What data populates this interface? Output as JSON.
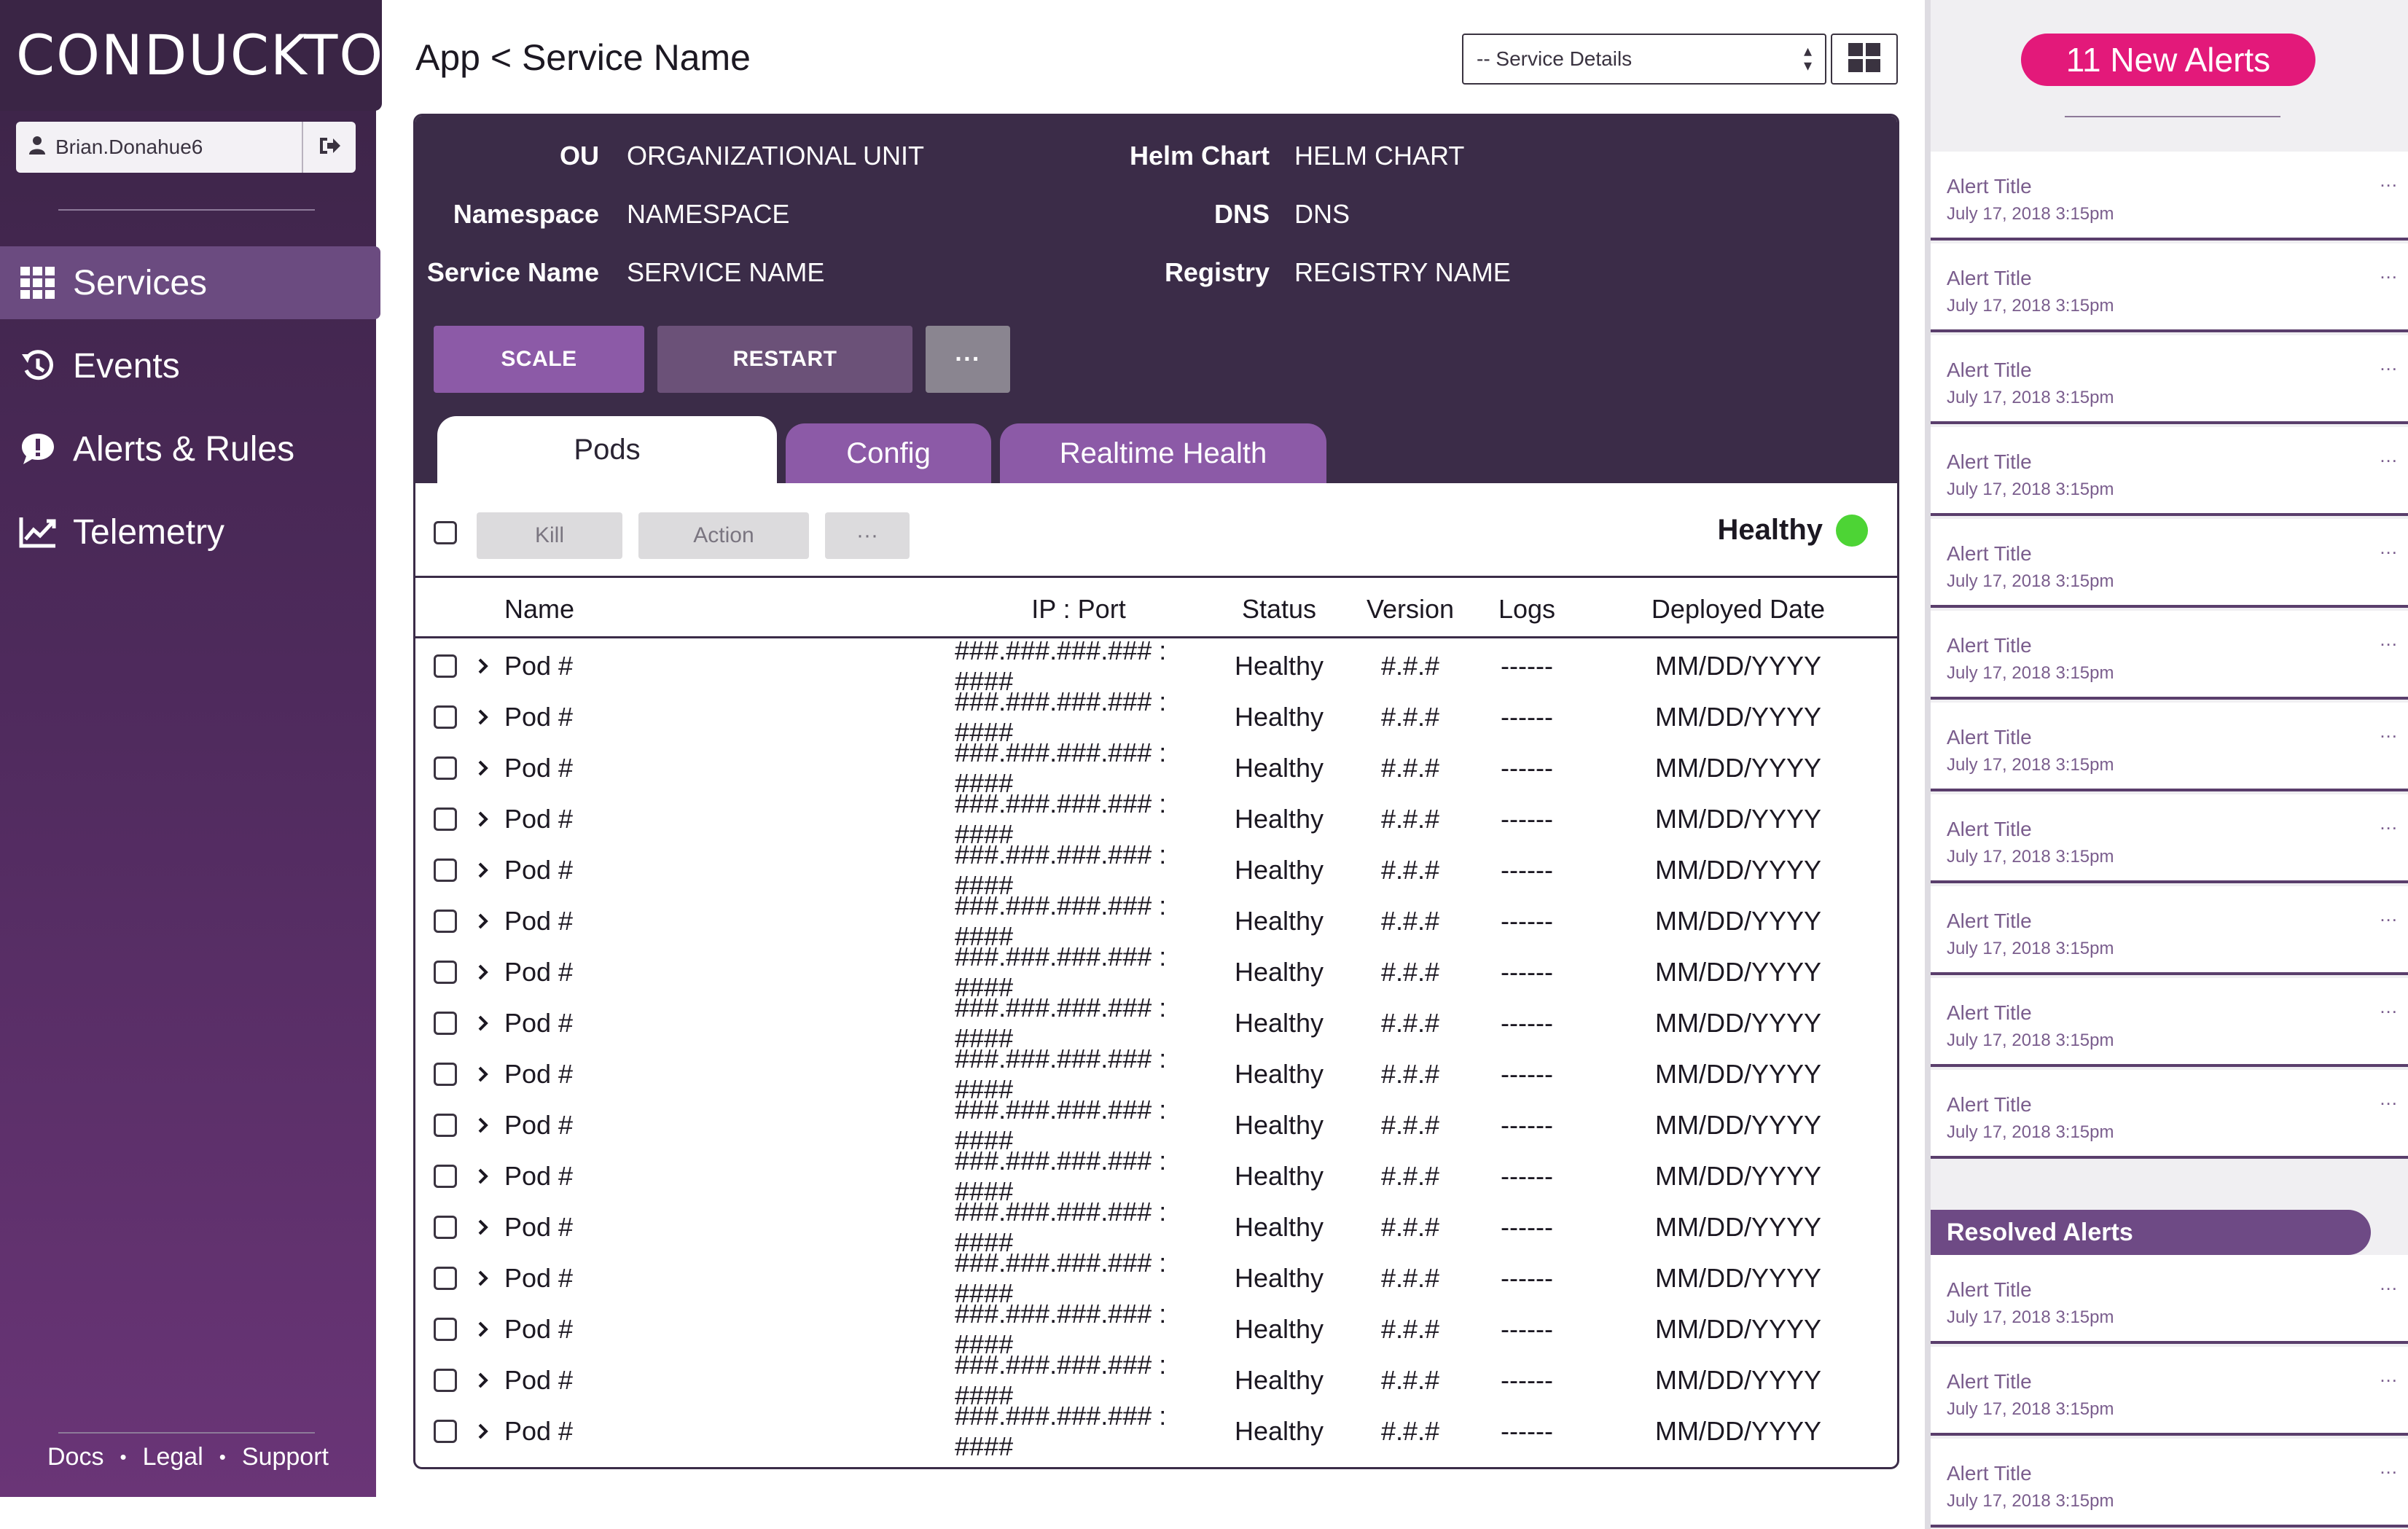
{
  "app": {
    "brand": "CONDUCKTOR",
    "username": "Brian.Donahue6",
    "breadcrumb": "App < Service Name"
  },
  "sidebar": {
    "items": [
      {
        "label": "Services",
        "icon": "grid-icon",
        "active": true
      },
      {
        "label": "Events",
        "icon": "history-icon",
        "active": false
      },
      {
        "label": "Alerts & Rules",
        "icon": "alert-bubble-icon",
        "active": false
      },
      {
        "label": "Telemetry",
        "icon": "line-chart-icon",
        "active": false
      }
    ],
    "footer": {
      "docs": "Docs",
      "legal": "Legal",
      "support": "Support",
      "separator": "•"
    }
  },
  "header": {
    "select_value": "-- Service Details"
  },
  "service": {
    "fields": [
      {
        "key": "OU",
        "value": "ORGANIZATIONAL UNIT"
      },
      {
        "key": "Namespace",
        "value": "NAMESPACE"
      },
      {
        "key": "Service Name",
        "value": "SERVICE NAME"
      },
      {
        "key": "Helm Chart",
        "value": "HELM CHART"
      },
      {
        "key": "DNS",
        "value": "DNS"
      },
      {
        "key": "Registry",
        "value": "REGISTRY NAME"
      }
    ],
    "actions": {
      "scale": "SCALE",
      "restart": "RESTART",
      "more": "···"
    }
  },
  "tabs": [
    {
      "label": "Pods",
      "active": true
    },
    {
      "label": "Config",
      "active": false
    },
    {
      "label": "Realtime Health",
      "active": false
    }
  ],
  "toolbar": {
    "kill": "Kill",
    "action": "Action",
    "more": "···",
    "health_label": "Healthy",
    "health_color": "#4dd435"
  },
  "table": {
    "columns": [
      "Name",
      "IP : Port",
      "Status",
      "Version",
      "Logs",
      "Deployed Date"
    ],
    "rows": [
      [
        "Pod #",
        "###.###.###.### : ####",
        "Healthy",
        "#.#.#",
        "------",
        "MM/DD/YYYY"
      ],
      [
        "Pod #",
        "###.###.###.### : ####",
        "Healthy",
        "#.#.#",
        "------",
        "MM/DD/YYYY"
      ],
      [
        "Pod #",
        "###.###.###.### : ####",
        "Healthy",
        "#.#.#",
        "------",
        "MM/DD/YYYY"
      ],
      [
        "Pod #",
        "###.###.###.### : ####",
        "Healthy",
        "#.#.#",
        "------",
        "MM/DD/YYYY"
      ],
      [
        "Pod #",
        "###.###.###.### : ####",
        "Healthy",
        "#.#.#",
        "------",
        "MM/DD/YYYY"
      ],
      [
        "Pod #",
        "###.###.###.### : ####",
        "Healthy",
        "#.#.#",
        "------",
        "MM/DD/YYYY"
      ],
      [
        "Pod #",
        "###.###.###.### : ####",
        "Healthy",
        "#.#.#",
        "------",
        "MM/DD/YYYY"
      ],
      [
        "Pod #",
        "###.###.###.### : ####",
        "Healthy",
        "#.#.#",
        "------",
        "MM/DD/YYYY"
      ],
      [
        "Pod #",
        "###.###.###.### : ####",
        "Healthy",
        "#.#.#",
        "------",
        "MM/DD/YYYY"
      ],
      [
        "Pod #",
        "###.###.###.### : ####",
        "Healthy",
        "#.#.#",
        "------",
        "MM/DD/YYYY"
      ],
      [
        "Pod #",
        "###.###.###.### : ####",
        "Healthy",
        "#.#.#",
        "------",
        "MM/DD/YYYY"
      ],
      [
        "Pod #",
        "###.###.###.### : ####",
        "Healthy",
        "#.#.#",
        "------",
        "MM/DD/YYYY"
      ],
      [
        "Pod #",
        "###.###.###.### : ####",
        "Healthy",
        "#.#.#",
        "------",
        "MM/DD/YYYY"
      ],
      [
        "Pod #",
        "###.###.###.### : ####",
        "Healthy",
        "#.#.#",
        "------",
        "MM/DD/YYYY"
      ],
      [
        "Pod #",
        "###.###.###.### : ####",
        "Healthy",
        "#.#.#",
        "------",
        "MM/DD/YYYY"
      ],
      [
        "Pod #",
        "###.###.###.### : ####",
        "Healthy",
        "#.#.#",
        "------",
        "MM/DD/YYYY"
      ]
    ]
  },
  "alerts": {
    "badge": "11 New Alerts",
    "new": [
      {
        "title": "Alert Title",
        "date": "July 17, 2018 3:15pm",
        "more": "..."
      },
      {
        "title": "Alert Title",
        "date": "July 17, 2018 3:15pm",
        "more": "..."
      },
      {
        "title": "Alert Title",
        "date": "July 17, 2018 3:15pm",
        "more": "..."
      },
      {
        "title": "Alert Title",
        "date": "July 17, 2018 3:15pm",
        "more": "..."
      },
      {
        "title": "Alert Title",
        "date": "July 17, 2018 3:15pm",
        "more": "..."
      },
      {
        "title": "Alert Title",
        "date": "July 17, 2018 3:15pm",
        "more": "..."
      },
      {
        "title": "Alert Title",
        "date": "July 17, 2018 3:15pm",
        "more": "..."
      },
      {
        "title": "Alert Title",
        "date": "July 17, 2018 3:15pm",
        "more": "..."
      },
      {
        "title": "Alert Title",
        "date": "July 17, 2018 3:15pm",
        "more": "..."
      },
      {
        "title": "Alert Title",
        "date": "July 17, 2018 3:15pm",
        "more": "..."
      },
      {
        "title": "Alert Title",
        "date": "July 17, 2018 3:15pm",
        "more": "..."
      }
    ],
    "resolved_heading": "Resolved Alerts",
    "resolved": [
      {
        "title": "Alert Title",
        "date": "July 17, 2018 3:15pm",
        "more": "..."
      },
      {
        "title": "Alert Title",
        "date": "July 17, 2018 3:15pm",
        "more": "..."
      },
      {
        "title": "Alert Title",
        "date": "July 17, 2018 3:15pm",
        "more": "..."
      }
    ]
  },
  "colors": {
    "sidebar": "#4e2a5c",
    "panel_header": "#3b2c48",
    "accent": "#8c5aa7",
    "alert_badge": "#e3197a",
    "healthy": "#4dd435"
  }
}
